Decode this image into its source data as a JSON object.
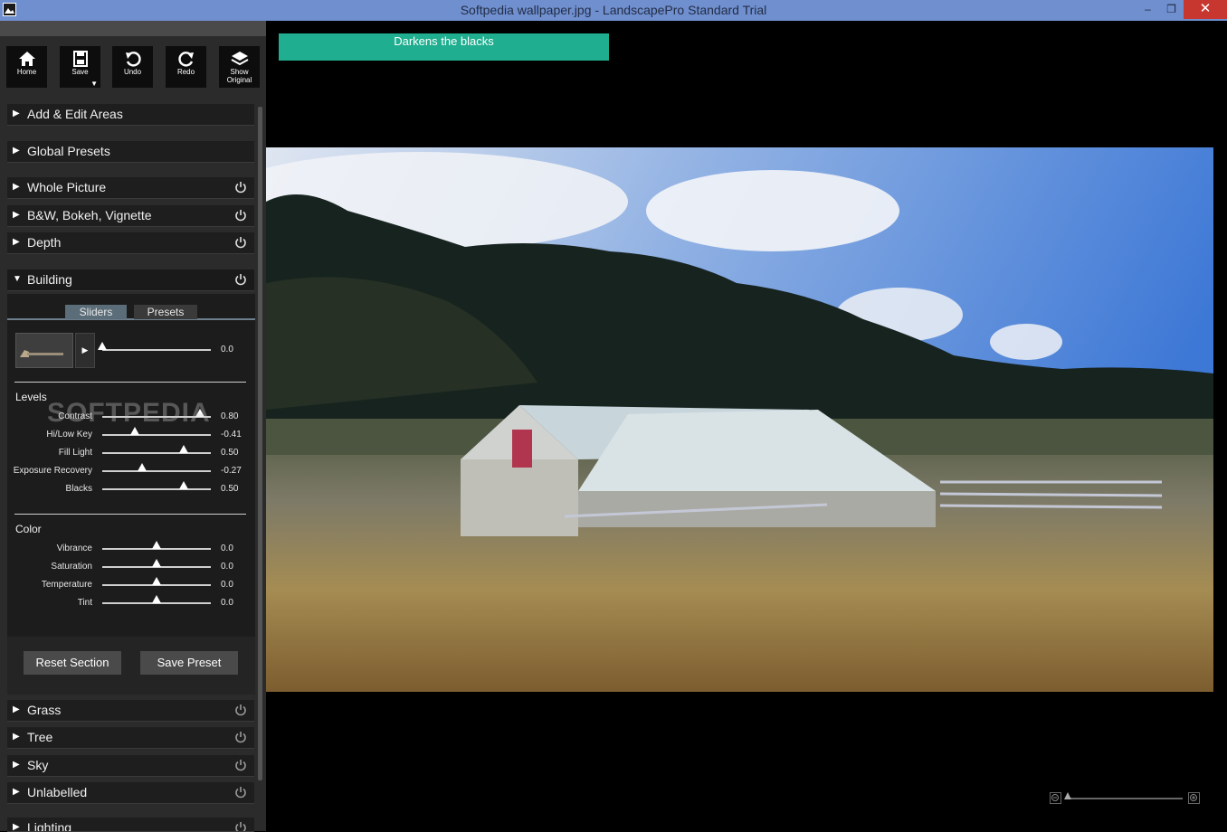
{
  "window": {
    "title": "Softpedia wallpaper.jpg - LandscapePro Standard Trial",
    "min": "–",
    "max": "❐",
    "close": "✕"
  },
  "toolbar": [
    {
      "label": "Home",
      "icon": "home-icon"
    },
    {
      "label": "Save",
      "icon": "save-icon"
    },
    {
      "label": "Undo",
      "icon": "undo-icon"
    },
    {
      "label": "Redo",
      "icon": "redo-icon"
    },
    {
      "label": "Show Original",
      "icon": "layers-icon"
    }
  ],
  "tooltip": "Darkens the blacks",
  "sections_top": [
    {
      "label": "Add & Edit Areas",
      "power": false
    },
    {
      "label": "Global Presets",
      "power": false
    },
    {
      "label": "Whole Picture",
      "power": true
    },
    {
      "label": "B&W, Bokeh, Vignette",
      "power": true
    },
    {
      "label": "Depth",
      "power": true
    }
  ],
  "open_section": {
    "label": "Building",
    "power": true
  },
  "tabs": {
    "sliders": "Sliders",
    "presets": "Presets",
    "active": "Sliders"
  },
  "area_slider": {
    "value": "0.0",
    "level": 0.0
  },
  "levels": {
    "title": "Levels",
    "sliders": [
      {
        "label": "Contrast",
        "value": "0.80",
        "level": 0.9
      },
      {
        "label": "Hi/Low Key",
        "value": "-0.41",
        "level": 0.3
      },
      {
        "label": "Fill Light",
        "value": "0.50",
        "level": 0.75
      },
      {
        "label": "Exposure Recovery",
        "value": "-0.27",
        "level": 0.365
      },
      {
        "label": "Blacks",
        "value": "0.50",
        "level": 0.75
      }
    ]
  },
  "color": {
    "title": "Color",
    "sliders": [
      {
        "label": "Vibrance",
        "value": "0.0",
        "level": 0.5
      },
      {
        "label": "Saturation",
        "value": "0.0",
        "level": 0.5
      },
      {
        "label": "Temperature",
        "value": "0.0",
        "level": 0.5
      },
      {
        "label": "Tint",
        "value": "0.0",
        "level": 0.5
      }
    ]
  },
  "buttons": {
    "reset": "Reset Section",
    "save_preset": "Save Preset"
  },
  "sections_bottom": [
    {
      "label": "Grass",
      "power": true
    },
    {
      "label": "Tree",
      "power": true
    },
    {
      "label": "Sky",
      "power": true
    },
    {
      "label": "Unlabelled",
      "power": true
    },
    {
      "label": "Lighting",
      "power": true
    }
  ],
  "watermark": "SOFTPEDIA",
  "zoom": {
    "level": 0.0
  },
  "colors": {
    "accent": "#1fae8f",
    "titlebar": "#6f8fcf",
    "panel": "#2b2b2b"
  }
}
